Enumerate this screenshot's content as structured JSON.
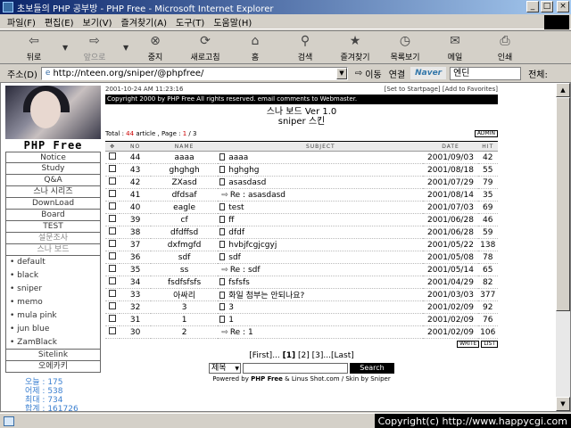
{
  "window": {
    "title": "초보들의 PHP 공부방 - PHP Free - Microsoft Internet Explorer",
    "min": "_",
    "max": "□",
    "close": "×"
  },
  "menu": [
    "파일(F)",
    "편집(E)",
    "보기(V)",
    "즐겨찾기(A)",
    "도구(T)",
    "도움말(H)"
  ],
  "toolbar": [
    {
      "label": "뒤로",
      "icon": "⇦",
      "name": "back"
    },
    {
      "label": "앞으로",
      "icon": "⇨",
      "name": "forward",
      "disabled": true
    },
    {
      "label": "중지",
      "icon": "⊗",
      "name": "stop"
    },
    {
      "label": "새로고침",
      "icon": "⟳",
      "name": "refresh"
    },
    {
      "label": "홈",
      "icon": "⌂",
      "name": "home"
    },
    {
      "label": "검색",
      "icon": "⚲",
      "name": "search"
    },
    {
      "label": "즐겨찾기",
      "icon": "★",
      "name": "favorites"
    },
    {
      "label": "목록보기",
      "icon": "◷",
      "name": "history"
    },
    {
      "label": "메일",
      "icon": "✉",
      "name": "mail"
    },
    {
      "label": "인쇄",
      "icon": "⎙",
      "name": "print"
    }
  ],
  "address": {
    "label": "주소(D)",
    "url": "http://nteen.org/sniper/@phpfree/",
    "go": "이동",
    "links": "연결",
    "naver": "Naver",
    "naver_value": "엔딘",
    "naver_all": "전체:"
  },
  "sidebar": {
    "site": "PHP Free",
    "menu": [
      "Notice",
      "Study",
      "Q&A",
      "스나 시리즈",
      "DownLoad",
      "Board",
      "TEST",
      "설문조사",
      "스나 보드"
    ],
    "subitems": [
      "default",
      "black",
      "sniper",
      "memo",
      "mula pink",
      "jun blue",
      "ZamBlack"
    ],
    "links": [
      "Sitelink",
      "오에카키"
    ],
    "counter": [
      "오늘 : 175",
      "어제 : 538",
      "최대 : 734",
      "합계 : 161726"
    ]
  },
  "board": {
    "datetime": "2001-10-24 AM 11:23:16",
    "top_links": "[Set to Startpage] [Add to Favorites]",
    "copyright": "Copyright 2000 by PHP Free All rights reserved. email comments to Webmaster.",
    "title": "스나 보드 Ver 1.0",
    "subtitle": "sniper 스킨",
    "total_prefix": "Total : ",
    "total_count": "44",
    "total_mid": " article , Page : ",
    "page_cur": "1",
    "page_sep": " / ",
    "page_total": "3",
    "admin": "ADMIN",
    "columns": {
      "no": "NO",
      "name": "NAME",
      "subject": "SUBJECT",
      "date": "DATE",
      "hit": "HIT"
    },
    "rows": [
      {
        "no": "44",
        "name": "aaaa",
        "subject": "aaaa",
        "date": "2001/09/03",
        "hit": "42"
      },
      {
        "no": "43",
        "name": "ghghgh",
        "subject": "hghghg",
        "date": "2001/08/18",
        "hit": "55"
      },
      {
        "no": "42",
        "name": "ZXasd",
        "subject": "asasdasd",
        "date": "2001/07/29",
        "hit": "79"
      },
      {
        "no": "41",
        "name": "dfdsaf",
        "subject": "Re : asasdasd",
        "date": "2001/08/14",
        "hit": "35",
        "reply": true
      },
      {
        "no": "40",
        "name": "eagle",
        "subject": "test",
        "date": "2001/07/03",
        "hit": "69"
      },
      {
        "no": "39",
        "name": "cf",
        "subject": "ff",
        "date": "2001/06/28",
        "hit": "46"
      },
      {
        "no": "38",
        "name": "dfdffsd",
        "subject": "dfdf",
        "date": "2001/06/28",
        "hit": "59"
      },
      {
        "no": "37",
        "name": "dxfmgfd",
        "subject": "hvbjfcgjcgyj",
        "date": "2001/05/22",
        "hit": "138"
      },
      {
        "no": "36",
        "name": "sdf",
        "subject": "sdf",
        "date": "2001/05/08",
        "hit": "78"
      },
      {
        "no": "35",
        "name": "ss",
        "subject": "Re : sdf",
        "date": "2001/05/14",
        "hit": "65",
        "reply": true
      },
      {
        "no": "34",
        "name": "fsdfsfsfs",
        "subject": "fsfsfs",
        "date": "2001/04/29",
        "hit": "82"
      },
      {
        "no": "33",
        "name": "아싸리",
        "subject": "화일 첨부는 안되나요?",
        "date": "2001/03/03",
        "hit": "377"
      },
      {
        "no": "32",
        "name": "3",
        "subject": "3",
        "date": "2001/02/09",
        "hit": "92"
      },
      {
        "no": "31",
        "name": "1",
        "subject": "1",
        "date": "2001/02/09",
        "hit": "76"
      },
      {
        "no": "30",
        "name": "2",
        "subject": "Re : 1",
        "date": "2001/02/09",
        "hit": "106",
        "reply": true
      }
    ],
    "write_btn": "WRITE",
    "list_btn": "LIST",
    "pager": {
      "first": "[First]",
      "dots1": "...",
      "p1": "[1]",
      "p2": "[2]",
      "p3": "[3]",
      "dots2": "...",
      "last": "[Last]"
    },
    "search_select": "제목",
    "search_button": "Search",
    "powered_prefix": "Powered by ",
    "powered_bold": "PHP Free",
    "powered_suffix": " & Linus Shot.com / Skin by Sniper"
  },
  "status": {
    "copyright": "Copyright(c) http://www.happycgi.com"
  }
}
